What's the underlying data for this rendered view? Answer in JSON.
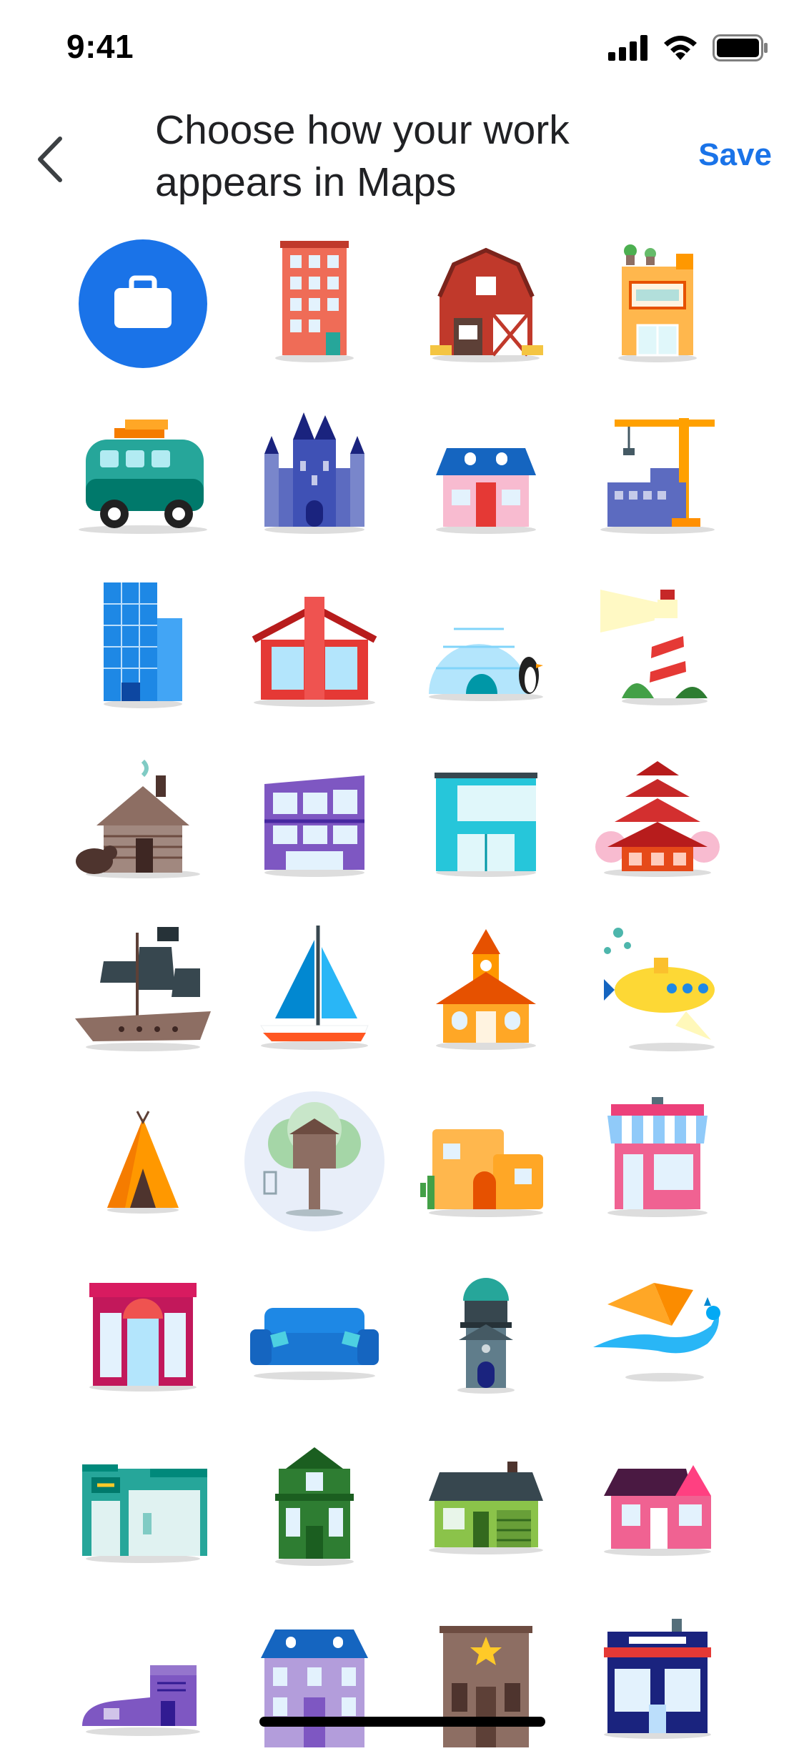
{
  "status": {
    "time": "9:41"
  },
  "header": {
    "back_icon": "chevron-left-icon",
    "title": "Choose how your work appears in Maps",
    "save_label": "Save"
  },
  "colors": {
    "accent": "#1a73e8",
    "selection_halo": "#e8eef9"
  },
  "icons": [
    {
      "name": "briefcase",
      "selected": true
    },
    {
      "name": "brick-apartment"
    },
    {
      "name": "barn"
    },
    {
      "name": "rooftop-garden-shop"
    },
    {
      "name": "camper-van"
    },
    {
      "name": "castle"
    },
    {
      "name": "pink-cottage"
    },
    {
      "name": "construction-crane"
    },
    {
      "name": "glass-skyscraper"
    },
    {
      "name": "modern-red-house"
    },
    {
      "name": "igloo"
    },
    {
      "name": "lighthouse"
    },
    {
      "name": "log-cabin"
    },
    {
      "name": "modern-apartment"
    },
    {
      "name": "teal-storefront"
    },
    {
      "name": "pagoda"
    },
    {
      "name": "pirate-ship"
    },
    {
      "name": "sailboat"
    },
    {
      "name": "schoolhouse"
    },
    {
      "name": "yellow-submarine"
    },
    {
      "name": "teepee"
    },
    {
      "name": "treehouse",
      "current": true
    },
    {
      "name": "adobe-house"
    },
    {
      "name": "striped-awning-shop"
    },
    {
      "name": "red-storefront"
    },
    {
      "name": "blue-couch"
    },
    {
      "name": "observatory-tower"
    },
    {
      "name": "dragon"
    },
    {
      "name": "gym"
    },
    {
      "name": "green-victorian-house"
    },
    {
      "name": "green-bungalow"
    },
    {
      "name": "pink-house"
    },
    {
      "name": "shoe-house"
    },
    {
      "name": "purple-mansion"
    },
    {
      "name": "sheriff-office"
    },
    {
      "name": "corner-shop"
    }
  ]
}
